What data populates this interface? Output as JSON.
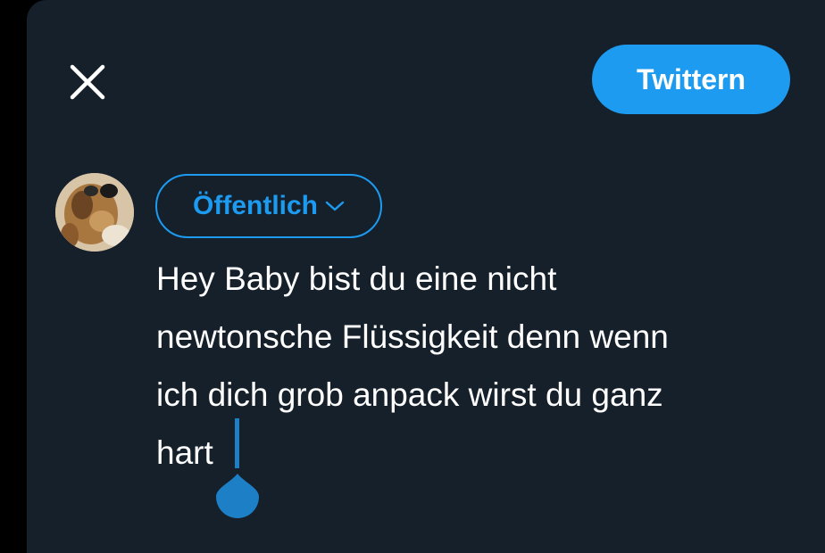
{
  "composer": {
    "close_icon": "close-icon",
    "tweet_button_label": "Twittern",
    "audience_label": "Öffentlich",
    "audience_icon": "chevron-down-icon",
    "tweet_text": "Hey Baby bist du eine nicht\nnewtonsche Flüssigkeit denn wenn\nich dich grob anpack wirst du ganz\nhart"
  },
  "colors": {
    "background": "#15202b",
    "accent": "#1d9bf0",
    "text": "#ffffff"
  }
}
